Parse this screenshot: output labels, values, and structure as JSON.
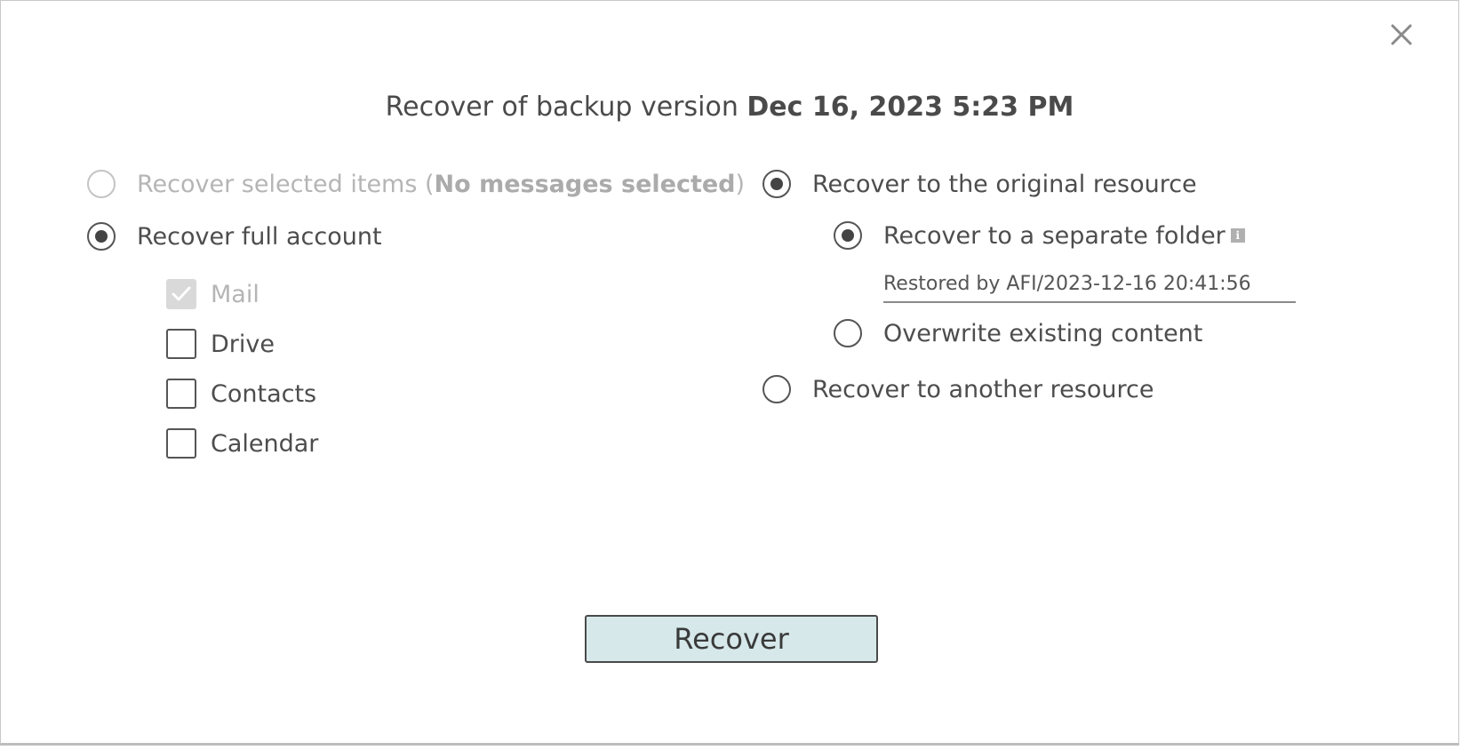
{
  "dialog": {
    "title_prefix": "Recover of backup version",
    "title_version": "Dec 16, 2023 5:23 PM"
  },
  "scope": {
    "selected_items_label": "Recover selected items (",
    "selected_items_bold": "No messages selected",
    "selected_items_suffix": ")",
    "full_account_label": "Recover full account"
  },
  "services": [
    {
      "label": "Mail",
      "checked": true,
      "disabled": true
    },
    {
      "label": "Drive",
      "checked": false,
      "disabled": false
    },
    {
      "label": "Contacts",
      "checked": false,
      "disabled": false
    },
    {
      "label": "Calendar",
      "checked": false,
      "disabled": false
    }
  ],
  "target": {
    "original_label": "Recover to the original resource",
    "separate_folder_label": "Recover to a separate folder",
    "info_icon_text": "i",
    "folder_name_value": "Restored by AFI/2023-12-16 20:41:56",
    "overwrite_label": "Overwrite existing content",
    "another_label": "Recover to another resource"
  },
  "actions": {
    "recover_label": "Recover",
    "close_symbol": "×"
  },
  "icons": {
    "close": "close-icon",
    "info": "info-icon",
    "check": "checkmark-icon"
  }
}
